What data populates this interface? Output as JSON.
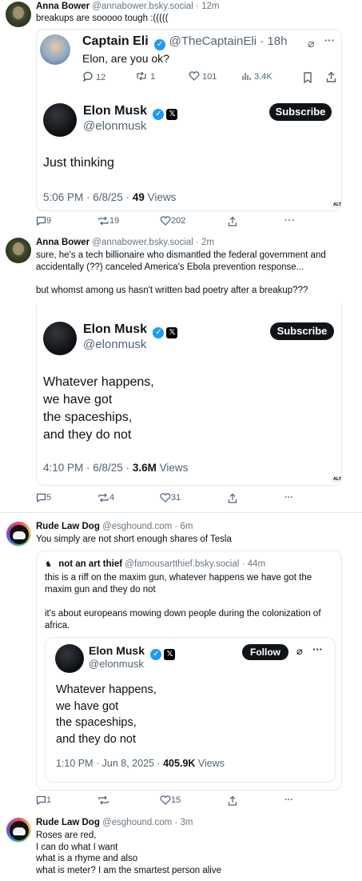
{
  "posts": [
    {
      "author": "Anna Bower",
      "handle": "@annabower.bsky.social",
      "time": "12m",
      "text": "breakups are sooooo tough :(((((",
      "quoted": {
        "author": "Captain Eli",
        "handle": "@TheCaptainEli",
        "time": "18h",
        "text": "Elon, are you ok?",
        "stats": {
          "replies": "12",
          "reposts": "1",
          "likes": "101",
          "views": "3.4K"
        },
        "embed": {
          "author": "Elon Musk",
          "handle": "@elonmusk",
          "button": "Subscribe",
          "text": "Just thinking",
          "time": "5:06 PM · 6/8/25 · ",
          "views_count": "49",
          "views_label": " Views",
          "alt": "ALT"
        }
      },
      "actions": {
        "replies": "9",
        "reposts": "19",
        "likes": "202"
      }
    },
    {
      "author": "Anna Bower",
      "handle": "@annabower.bsky.social",
      "time": "2m",
      "text_lines": [
        "sure, he's a tech billionaire who dismantled the federal government and",
        "accidentally (??) canceled America's Ebola prevention response...",
        "",
        "but whomst among us hasn't written bad poetry after a breakup???"
      ],
      "embed": {
        "author": "Elon Musk",
        "handle": "@elonmusk",
        "button": "Subscribe",
        "lines": [
          "Whatever happens,",
          "we have got",
          "the spaceships,",
          "and they do not"
        ],
        "time": "4:10 PM · 6/8/25 · ",
        "views_count": "3.6M",
        "views_label": " Views",
        "alt": "ALT"
      },
      "actions": {
        "replies": "5",
        "reposts": "4",
        "likes": "31"
      }
    },
    {
      "author": "Rude Law Dog",
      "handle": "@esghound.com",
      "time": "6m",
      "text": "You simply are not short enough shares of Tesla",
      "quoted": {
        "author": "not an art thief",
        "handle": "@famousartthief.bsky.social",
        "time": "44m",
        "text_lines": [
          "this is a riff on the maxim gun, whatever happens we have got the",
          "maxim gun and they do not",
          "",
          "it's about europeans mowing down people during the colonization of",
          "africa."
        ],
        "embed": {
          "author": "Elon Musk",
          "handle": "@elonmusk",
          "button": "Follow",
          "lines": [
            "Whatever happens,",
            "we have got",
            "the spaceships,",
            "and they do not"
          ],
          "time": "1:10 PM · Jun 8, 2025 · ",
          "views_count": "405.9K",
          "views_label": " Views"
        }
      },
      "actions": {
        "replies": "1",
        "reposts": "",
        "likes": "15"
      }
    },
    {
      "author": "Rude Law Dog",
      "handle": "@esghound.com",
      "time": "3m",
      "text_lines": [
        "Roses are red,",
        "I can do what I want",
        "what is a rhyme and also",
        "what is meter? I am the smartest person alive"
      ]
    }
  ],
  "separator": " · ",
  "colors": {
    "accent": "#1d9bf0",
    "muted": "#687684",
    "border": "#e6e9ec"
  }
}
